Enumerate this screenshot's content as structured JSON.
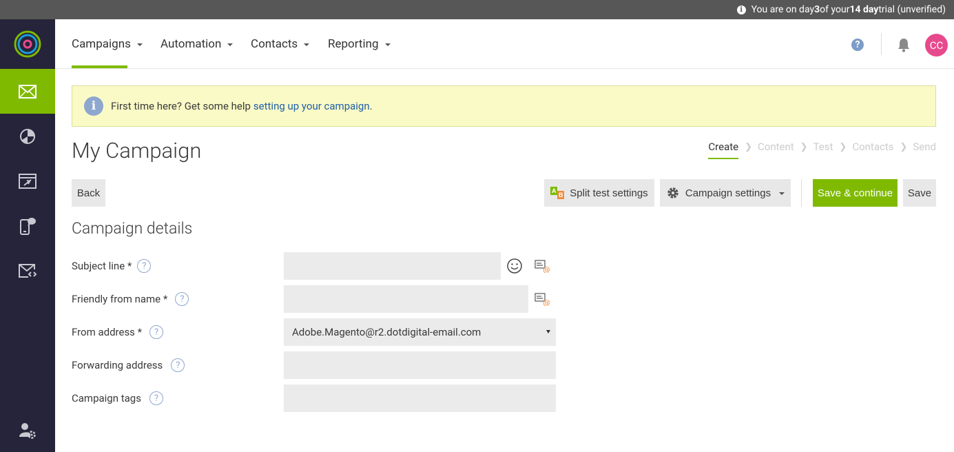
{
  "trial": {
    "prefix": "You are on day ",
    "day": "3",
    "middle": " of your ",
    "length": "14 day",
    "suffix": " trial (unverified)"
  },
  "nav": {
    "items": [
      {
        "label": "Campaigns"
      },
      {
        "label": "Automation"
      },
      {
        "label": "Contacts"
      },
      {
        "label": "Reporting"
      }
    ],
    "help_glyph": "?",
    "avatar_initials": "CC"
  },
  "banner": {
    "text": "First time here? Get some help",
    "link": "setting up your campaign",
    "period": ".",
    "icon_glyph": "i"
  },
  "page": {
    "title": "My Campaign"
  },
  "steps": [
    {
      "label": "Create",
      "active": true
    },
    {
      "label": "Content",
      "active": false
    },
    {
      "label": "Test",
      "active": false
    },
    {
      "label": "Contacts",
      "active": false
    },
    {
      "label": "Send",
      "active": false
    }
  ],
  "toolbar": {
    "back": "Back",
    "split_test": "Split test settings",
    "campaign_settings": "Campaign settings",
    "save_continue": "Save & continue",
    "save": "Save",
    "ab_a": "A",
    "ab_b": "B"
  },
  "section": {
    "title": "Campaign details"
  },
  "form": {
    "subject_label": "Subject line *",
    "subject_value": "",
    "friendly_label": "Friendly from name *",
    "friendly_value": "",
    "from_label": "From address *",
    "from_value": "Adobe.Magento@r2.dotdigital-email.com",
    "forwarding_label": "Forwarding address",
    "forwarding_value": "",
    "tags_label": "Campaign tags",
    "tags_value": "",
    "help_glyph": "?"
  },
  "colors": {
    "accent": "#7fba00",
    "sidebar": "#26243a",
    "avatar": "#e64a8d",
    "link": "#1f5fa8"
  }
}
